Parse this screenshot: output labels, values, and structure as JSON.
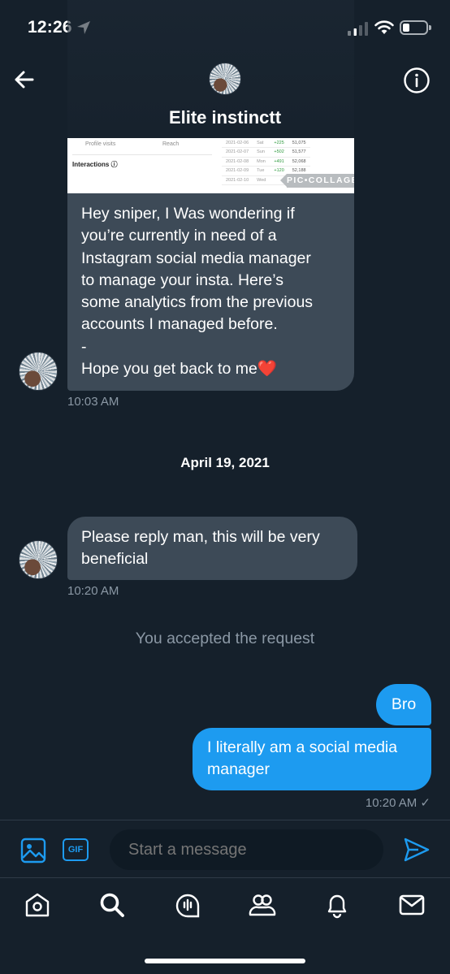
{
  "status_bar": {
    "time": "12:26"
  },
  "header": {
    "title": "Elite instinctt"
  },
  "media": {
    "labels": {
      "profile_visits": "Profile visits",
      "reach": "Reach",
      "interactions": "Interactions ⓘ"
    },
    "rows": [
      {
        "date": "2021-02-06",
        "day": "Sat",
        "delta": "+225",
        "total": "51,075"
      },
      {
        "date": "2021-02-07",
        "day": "Sun",
        "delta": "+502",
        "total": "51,577"
      },
      {
        "date": "2021-02-08",
        "day": "Mon",
        "delta": "+491",
        "total": "52,068"
      },
      {
        "date": "2021-02-09",
        "day": "Tue",
        "delta": "+120",
        "total": "52,188"
      },
      {
        "date": "2021-02-10",
        "day": "Wed",
        "delta": "",
        "total": ""
      }
    ],
    "watermark": "PIC•COLLAGE"
  },
  "messages": {
    "first": {
      "lines": [
        "Hey sniper, I Was wondering if",
        "you’re currently in need of a",
        "Instagram social media manager",
        "to manage your insta. Here’s",
        "some analytics from the previous",
        "accounts I managed before.",
        "-",
        "Hope you get back to me❤️"
      ],
      "time": "10:03 AM"
    },
    "date_separator": "April 19, 2021",
    "second": {
      "lines": [
        "Please reply man, this will be very",
        "beneficial"
      ],
      "time": "10:20 AM"
    },
    "system_notice": "You accepted the request",
    "outgoing_1": {
      "text": "Bro"
    },
    "outgoing_2": {
      "lines": [
        "I literally am a social media",
        "manager"
      ],
      "time": "10:20 AM ✓"
    }
  },
  "compose": {
    "placeholder": "Start a message",
    "gif_label": "GIF"
  },
  "colors": {
    "background": "#15202b",
    "accent": "#1d9bf0",
    "incoming_bubble": "#3d4a57"
  },
  "icons": {
    "nav": [
      "home-icon",
      "search-icon",
      "spaces-icon",
      "communities-icon",
      "notifications-icon",
      "messages-icon"
    ]
  }
}
